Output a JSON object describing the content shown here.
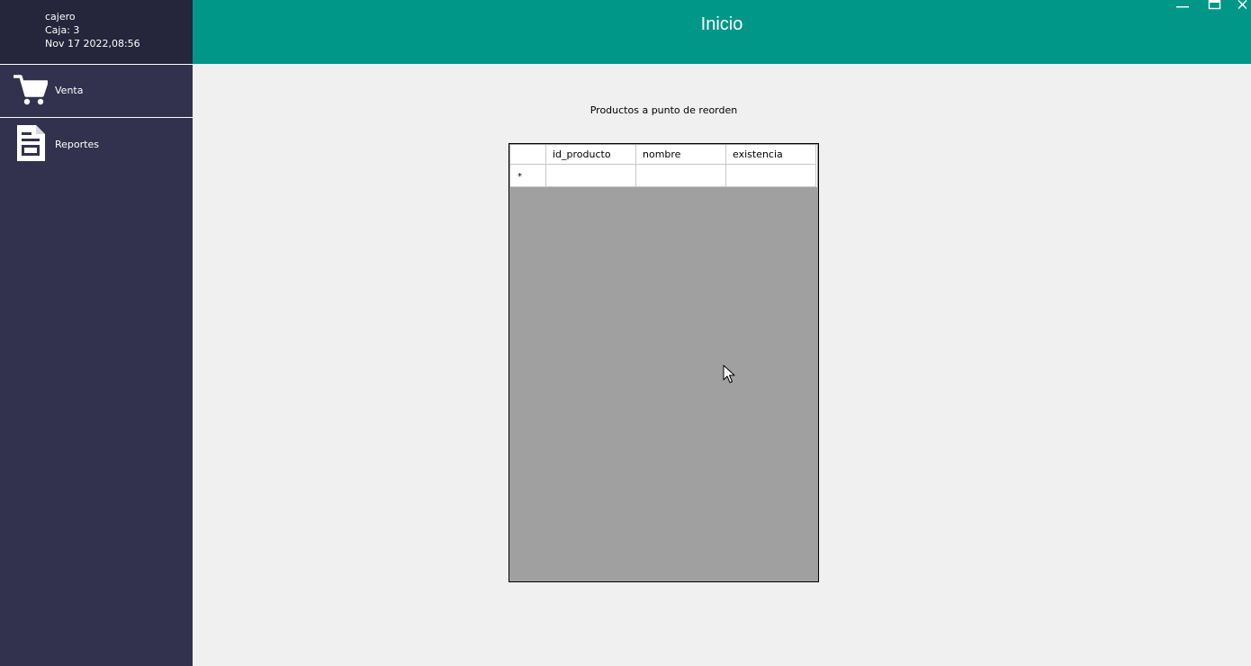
{
  "window": {
    "title": "Inicio",
    "controls": {
      "minimize": "minimize-icon",
      "maximize": "maximize-icon",
      "close": "close-icon"
    }
  },
  "user": {
    "role": "cajero",
    "register": "Caja: 3",
    "datetime": "Nov 17 2022,08:56"
  },
  "sidebar": {
    "items": [
      {
        "label": "Venta",
        "icon": "cart-icon"
      },
      {
        "label": "Reportes",
        "icon": "report-icon"
      }
    ]
  },
  "main": {
    "table_title": "Productos a punto de reorden",
    "columns": [
      "id_producto",
      "nombre",
      "existencia"
    ],
    "rows": [],
    "new_row_marker": "*"
  },
  "colors": {
    "header": "#009688",
    "sidebar": "#32324e",
    "user_panel": "#25253b",
    "background": "#f0f0f0",
    "grid_empty": "#a0a0a0"
  }
}
